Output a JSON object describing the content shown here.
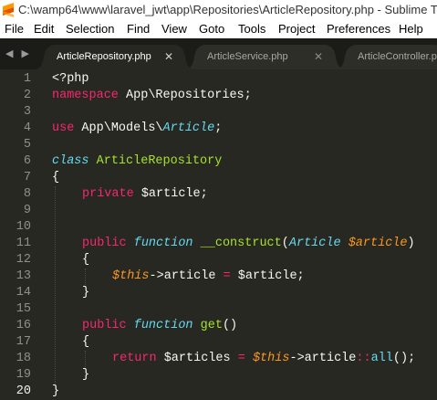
{
  "window": {
    "title": "C:\\wamp64\\www\\laravel_jwt\\app\\Repositories\\ArticleRepository.php - Sublime Text",
    "app_icon": "sublime-text-icon"
  },
  "menu": [
    "File",
    "Edit",
    "Selection",
    "Find",
    "View",
    "Goto",
    "Tools",
    "Project",
    "Preferences",
    "Help"
  ],
  "tabs": [
    {
      "label": "ArticleRepository.php",
      "close": "✕",
      "active": true
    },
    {
      "label": "ArticleService.php",
      "close": "✕",
      "active": false
    },
    {
      "label": "ArticleController.php",
      "close": "",
      "active": false
    }
  ],
  "nav_arrows": "◀ ▶",
  "line_numbers": [
    "1",
    "2",
    "3",
    "4",
    "5",
    "6",
    "7",
    "8",
    "9",
    "10",
    "11",
    "12",
    "13",
    "14",
    "15",
    "16",
    "17",
    "18",
    "19",
    "20"
  ],
  "current_line": 20,
  "code": {
    "l1": {
      "a": "<?php"
    },
    "l2": {
      "a": "namespace",
      "b": " App\\Repositories;"
    },
    "l4": {
      "a": "use",
      "b": " App\\Models\\",
      "c": "Article",
      "d": ";"
    },
    "l6": {
      "a": "class",
      "b": " ",
      "c": "ArticleRepository"
    },
    "l7": {
      "a": "{"
    },
    "l8": {
      "a": "private",
      "b": " $article;"
    },
    "l11": {
      "a": "public",
      "b": " ",
      "c": "function",
      "d": " ",
      "e": "__construct",
      "f": "(",
      "g": "Article",
      "h": " ",
      "i": "$article",
      "j": ")"
    },
    "l12": {
      "a": "{"
    },
    "l13": {
      "a": "$this",
      "b": "->article ",
      "c": "=",
      "d": " $article;"
    },
    "l14": {
      "a": "}"
    },
    "l16": {
      "a": "public",
      "b": " ",
      "c": "function",
      "d": " ",
      "e": "get",
      "f": "()"
    },
    "l17": {
      "a": "{"
    },
    "l18": {
      "a": "return",
      "b": " $articles ",
      "c": "=",
      "d": " ",
      "e": "$this",
      "f": "->article",
      "g": "::",
      "h": "all",
      "i": "();"
    },
    "l19": {
      "a": "}"
    },
    "l20": {
      "a": "}"
    }
  },
  "colors": {
    "background": "#272822",
    "keyword": "#f92672",
    "storage": "#66d9ef",
    "entity": "#a6e22e",
    "variable": "#fd971f",
    "text": "#f8f8f2"
  }
}
